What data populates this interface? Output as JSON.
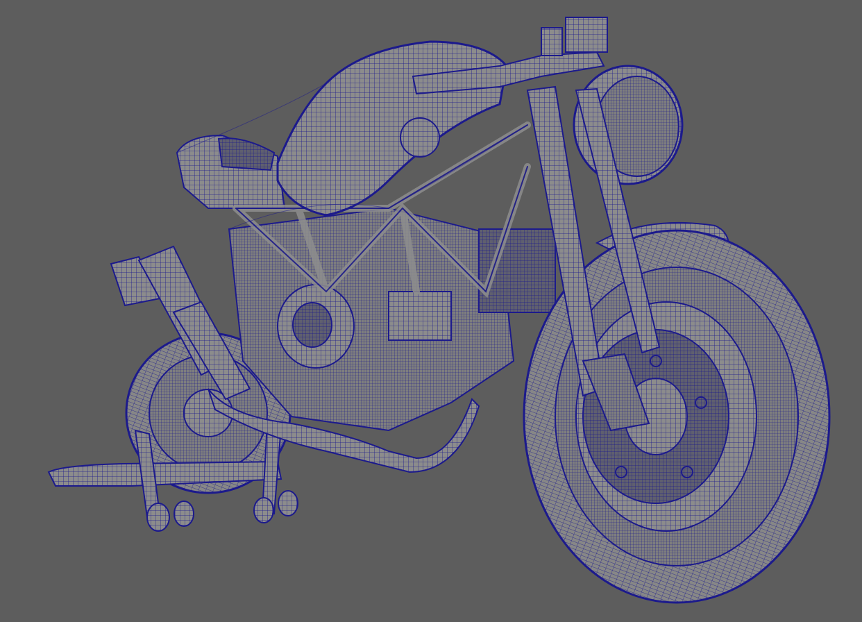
{
  "viewport": {
    "background_color": "#5d5d5d",
    "shading_mode": "wireframe-on-shaded",
    "wire_color": "#1c1a8c",
    "surface_color": "#8e8e8e",
    "subject": "motorcycle-model"
  }
}
